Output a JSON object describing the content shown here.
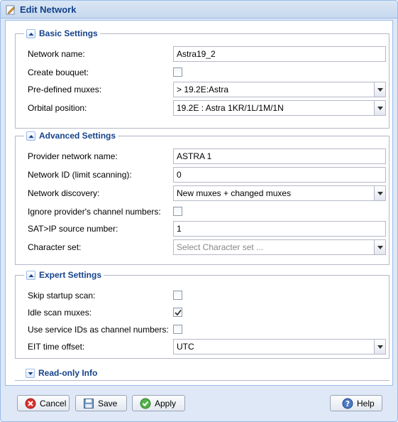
{
  "window": {
    "title": "Edit Network"
  },
  "basic": {
    "title": "Basic Settings",
    "network_name": {
      "label": "Network name:",
      "value": "Astra19_2"
    },
    "create_bouquet": {
      "label": "Create bouquet:",
      "checked": false
    },
    "predefined_muxes": {
      "label": "Pre-defined muxes:",
      "value": "> 19.2E:Astra"
    },
    "orbital_position": {
      "label": "Orbital position:",
      "value": "19.2E : Astra 1KR/1L/1M/1N"
    }
  },
  "advanced": {
    "title": "Advanced Settings",
    "provider_network_name": {
      "label": "Provider network name:",
      "value": "ASTRA 1"
    },
    "network_id": {
      "label": "Network ID (limit scanning):",
      "value": "0"
    },
    "network_discovery": {
      "label": "Network discovery:",
      "value": "New muxes + changed muxes"
    },
    "ignore_channel_numbers": {
      "label": "Ignore provider's channel numbers:",
      "checked": false
    },
    "satip_source": {
      "label": "SAT>IP source number:",
      "value": "1"
    },
    "character_set": {
      "label": "Character set:",
      "placeholder": "Select Character set ..."
    }
  },
  "expert": {
    "title": "Expert Settings",
    "skip_startup_scan": {
      "label": "Skip startup scan:",
      "checked": false
    },
    "idle_scan_muxes": {
      "label": "Idle scan muxes:",
      "checked": true
    },
    "service_ids": {
      "label": "Use service IDs as channel numbers:",
      "checked": false
    },
    "eit_offset": {
      "label": "EIT time offset:",
      "value": "UTC"
    }
  },
  "readonly": {
    "title": "Read-only Info"
  },
  "buttons": {
    "cancel": "Cancel",
    "save": "Save",
    "apply": "Apply",
    "help": "Help"
  },
  "colors": {
    "accent": "#15428b",
    "border": "#99bbe8",
    "window_bg": "#dfe8f6"
  }
}
